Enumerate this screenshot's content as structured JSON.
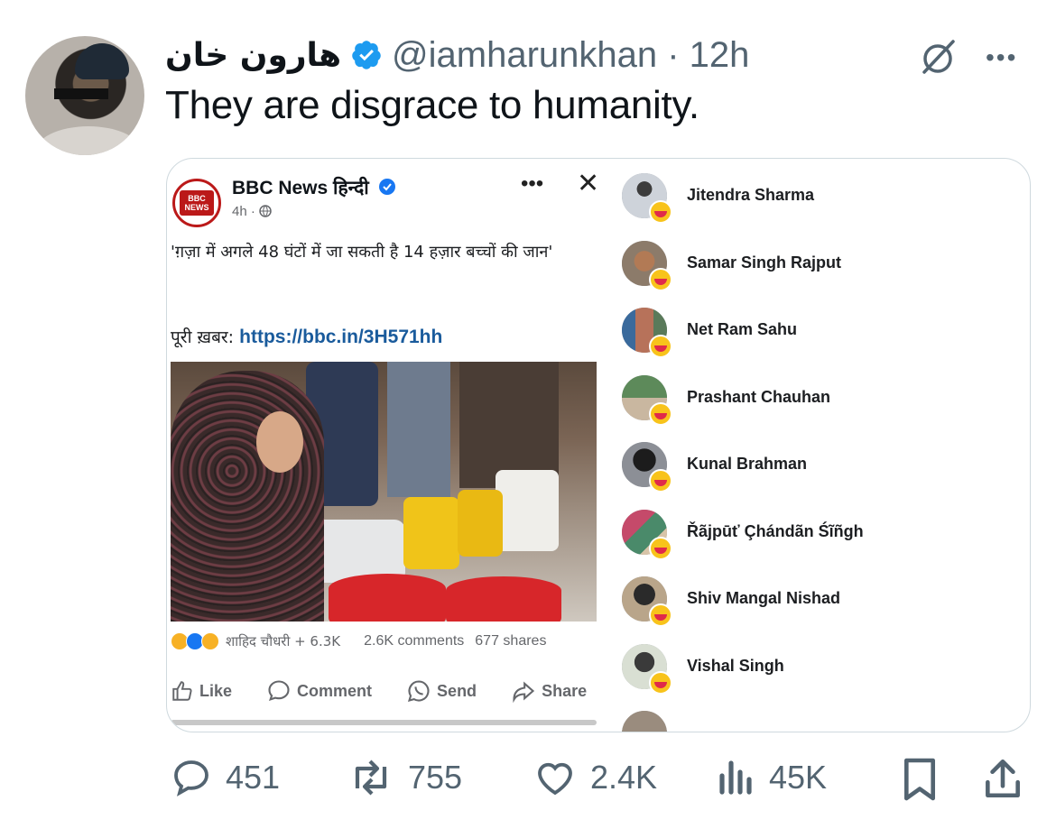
{
  "tweet": {
    "author_name": "هارون خان",
    "handle_time": "@iamharunkhan · 12h",
    "text": "They are disgrace to humanity.",
    "more_label": "•••"
  },
  "embedded": {
    "page_name": "BBC News हिन्दी",
    "logo_line1": "BBC",
    "logo_line2": "NEWS",
    "time": "4h · ",
    "post_text": "'ग़ज़ा में अगले 48 घंटों में जा सकती है 14 हज़ार बच्चों की जान'",
    "link_prefix": "पूरी ख़बर: ",
    "link": "https://bbc.in/3H571hh",
    "reactor": "शाहिद चौधरी + 6.3K",
    "comments": "2.6K comments",
    "shares": "677 shares",
    "actions": {
      "like": "Like",
      "comment": "Comment",
      "send": "Send",
      "share": "Share"
    },
    "reactors_list": [
      "Jitendra Sharma",
      "Samar Singh Rajput",
      "Net Ram Sahu",
      "Prashant Chauhan",
      "Kunal Brahman",
      "Řãjpūť Çhándãn Śĩñgh",
      "Shiv Mangal Nishad",
      "Vishal Singh"
    ]
  },
  "stats": {
    "replies": "451",
    "reposts": "755",
    "likes": "2.4K",
    "views": "45K"
  },
  "colors": {
    "secondary_text": "#536471",
    "verified_blue": "#1d9bf0",
    "fb_link": "#1a5b9c",
    "bbc_red": "#bb1919"
  }
}
